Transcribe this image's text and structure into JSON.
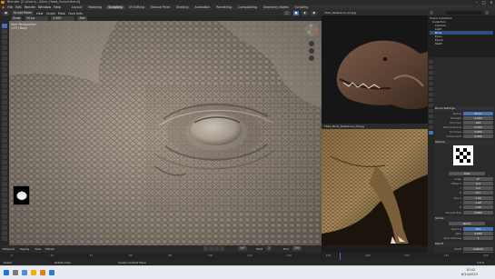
{
  "window": {
    "title": "Blender [C:\\Users\\...\\Dino_Head_Sculpt.blend]",
    "controls": [
      "–",
      "□",
      "×"
    ]
  },
  "menubar": {
    "menus": [
      "File",
      "Edit",
      "Render",
      "Window",
      "Help"
    ],
    "workspaces": [
      "Layout",
      "Modeling",
      "Sculpting",
      "UV Editing",
      "Texture Paint",
      "Shading",
      "Animation",
      "Rendering",
      "Compositing",
      "Geometry Nodes",
      "Scripting"
    ],
    "active_workspace": "Sculpting"
  },
  "viewport": {
    "mode": "Sculpt Mode",
    "header_items": [
      "View",
      "Sculpt",
      "Mask",
      "Face Sets"
    ],
    "brush_name": "Draw",
    "overlay_line1": "User Perspective",
    "overlay_line2": "(197) Body",
    "shading_modes": [
      "wire",
      "solid",
      "material",
      "rendered"
    ]
  },
  "timeline": {
    "items": [
      "Playback",
      "Keying",
      "View",
      "Marker"
    ],
    "frame_current": "197",
    "start_label": "Start",
    "start": "1",
    "end_label": "End",
    "end": "250",
    "ruler_ticks": [
      "0",
      "20",
      "40",
      "60",
      "80",
      "100",
      "120",
      "140",
      "160",
      "180",
      "200",
      "220",
      "240"
    ]
  },
  "reference_top": {
    "title": "TRex_Reference_01.jpg"
  },
  "reference_bottom": {
    "title": "TRex_Body_Reference_02.jpg"
  },
  "outliner": {
    "title": "Scene Collection",
    "rows": [
      {
        "label": "Scene Collection",
        "selected": false
      },
      {
        "label": "Collection",
        "selected": false
      },
      {
        "label": "Camera",
        "selected": false
      },
      {
        "label": "Light",
        "selected": false
      },
      {
        "label": "Body",
        "selected": true
      },
      {
        "label": "Eye.L",
        "selected": false
      },
      {
        "label": "Eye.R",
        "selected": false
      },
      {
        "label": "Teeth",
        "selected": false
      }
    ]
  },
  "properties": {
    "sections": [
      "Brushes",
      "Brush Settings",
      "Texture",
      "Stroke",
      "Falloff",
      "Cursor"
    ],
    "rows_top": [
      {
        "label": "Radius",
        "value": "50 px",
        "blue": true
      },
      {
        "label": "Strength",
        "value": "0.500",
        "blue": false
      },
      {
        "label": "Direction",
        "value": "Add",
        "blue": false
      },
      {
        "label": "Normal Radius",
        "value": "0.500",
        "blue": false
      },
      {
        "label": "Hardness",
        "value": "0.000",
        "blue": false
      },
      {
        "label": "Autosmooth",
        "value": "0.000",
        "blue": false
      }
    ],
    "texture_mapping": "Tiled",
    "rows_mid": [
      {
        "label": "Angle",
        "value": "0°"
      },
      {
        "label": "Offset X",
        "value": "0 m"
      },
      {
        "label": "Y",
        "value": "0 m"
      },
      {
        "label": "Z",
        "value": "0 m"
      },
      {
        "label": "Size X",
        "value": "1.00"
      },
      {
        "label": "Y",
        "value": "1.00"
      },
      {
        "label": "Z",
        "value": "1.00"
      },
      {
        "label": "Sample Bias",
        "value": "0.000"
      }
    ],
    "stroke_method": "Space",
    "rows_bottom": [
      {
        "label": "Spacing",
        "value": "10%"
      },
      {
        "label": "Jitter",
        "value": "0.000"
      },
      {
        "label": "Input Samples",
        "value": "1"
      },
      {
        "label": "Falloff",
        "value": "Custom"
      },
      {
        "label": "Shape",
        "value": "Sphere"
      },
      {
        "label": "Normal",
        "value": "0.000"
      }
    ]
  },
  "statusbar": {
    "left": "Select",
    "middle": "Rotate View",
    "right": "Sculpt Context Menu",
    "version": "3.6.0"
  },
  "taskbar": {
    "time": "10:42",
    "date": "6/14/2023"
  },
  "colors": {
    "accent": "#4772b3",
    "selected_row": "#334d80",
    "clay": "#a4988a"
  }
}
